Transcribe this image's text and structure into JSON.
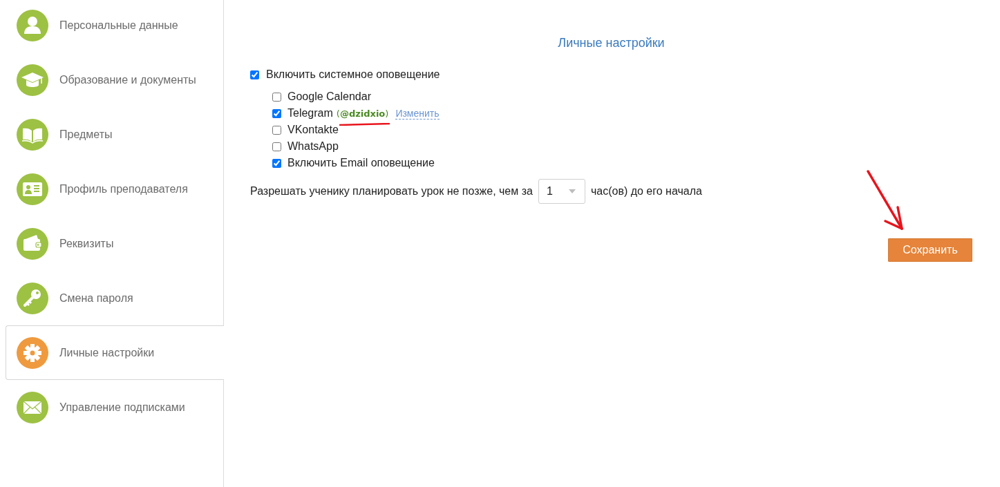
{
  "sidebar": {
    "items": [
      {
        "label": "Персональные данные",
        "selected": false
      },
      {
        "label": "Образование и документы",
        "selected": false
      },
      {
        "label": "Предметы",
        "selected": false
      },
      {
        "label": "Профиль преподавателя",
        "selected": false
      },
      {
        "label": "Реквизиты",
        "selected": false
      },
      {
        "label": "Смена пароля",
        "selected": false
      },
      {
        "label": "Личные настройки",
        "selected": true
      },
      {
        "label": "Управление подписками",
        "selected": false
      }
    ]
  },
  "main": {
    "title": "Личные настройки",
    "system_notification": {
      "label": "Включить системное оповещение",
      "checked": true
    },
    "channels": [
      {
        "label": "Google Calendar",
        "checked": false
      },
      {
        "label": "Telegram",
        "checked": true,
        "account": "(**@dzidxio**)",
        "action": "Изменить"
      },
      {
        "label": "VKontakte",
        "checked": false
      },
      {
        "label": "WhatsApp",
        "checked": false
      },
      {
        "label": "Включить Email оповещение",
        "checked": true
      }
    ],
    "planning": {
      "before": "Разрешать ученику планировать урок не позже, чем за",
      "value": "1",
      "after": "час(ов) до его начала"
    },
    "save_button": "Сохранить"
  }
}
